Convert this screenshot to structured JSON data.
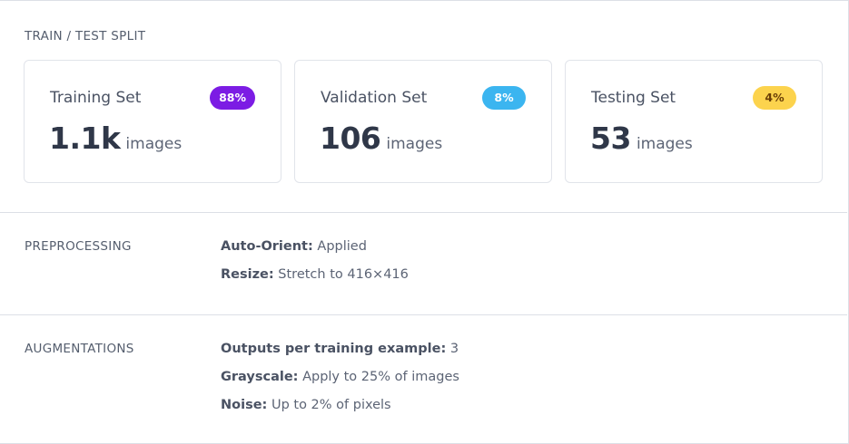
{
  "split": {
    "title": "TRAIN / TEST SPLIT",
    "cards": [
      {
        "title": "Training Set",
        "badge": "88%",
        "badge_color": "#7c1ce4",
        "count": "1.1k",
        "unit": "images"
      },
      {
        "title": "Validation Set",
        "badge": "8%",
        "badge_color": "#3bb5f0",
        "count": "106",
        "unit": "images"
      },
      {
        "title": "Testing Set",
        "badge": "4%",
        "badge_color": "#fcd34d",
        "count": "53",
        "unit": "images"
      }
    ]
  },
  "preprocessing": {
    "title": "PREPROCESSING",
    "items": [
      {
        "key": "Auto-Orient:",
        "value": "Applied"
      },
      {
        "key": "Resize:",
        "value": "Stretch to 416×416"
      }
    ]
  },
  "augmentations": {
    "title": "AUGMENTATIONS",
    "items": [
      {
        "key": "Outputs per training example:",
        "value": "3"
      },
      {
        "key": "Grayscale:",
        "value": "Apply to 25% of images"
      },
      {
        "key": "Noise:",
        "value": "Up to 2% of pixels"
      }
    ]
  }
}
